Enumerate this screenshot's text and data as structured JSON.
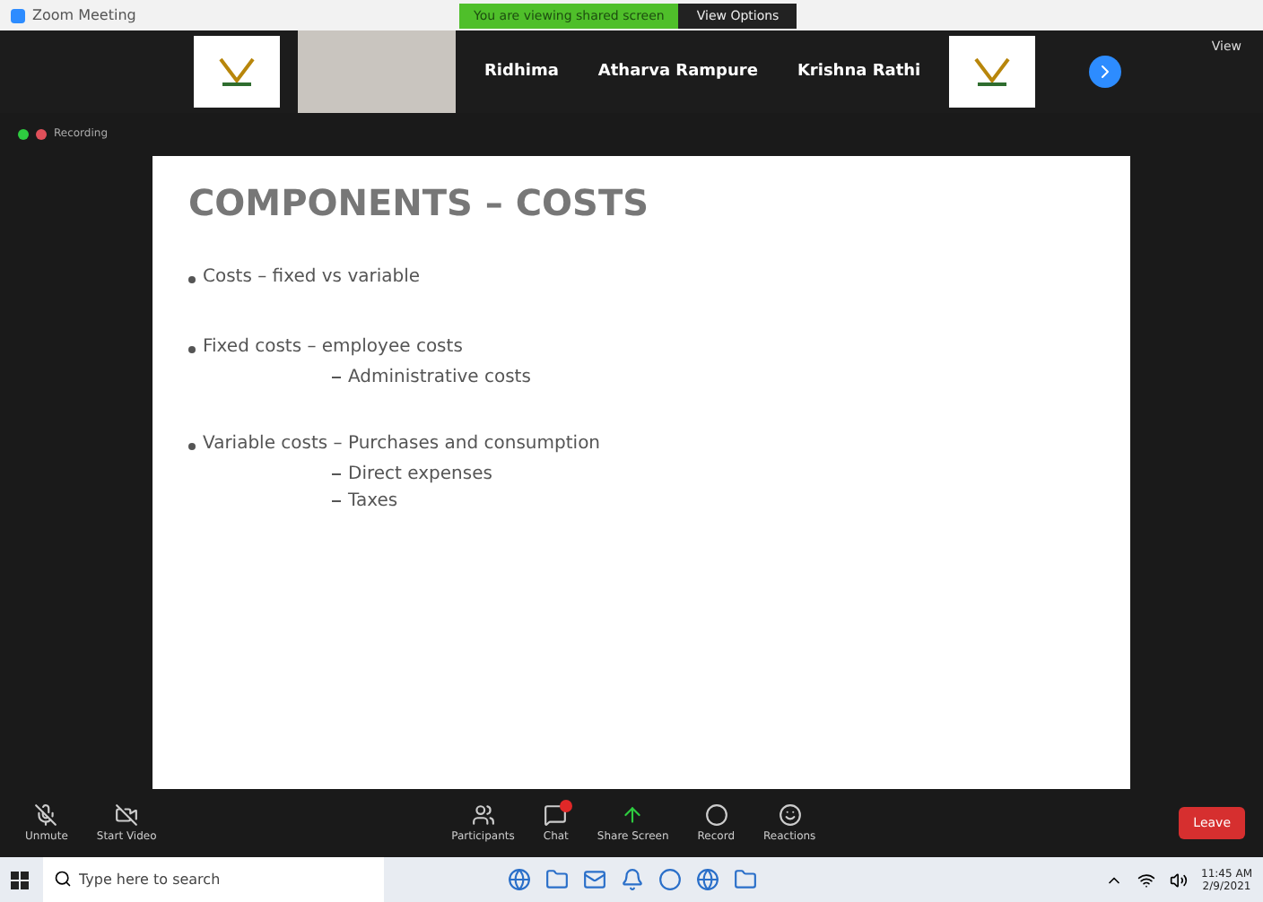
{
  "window": {
    "title": "Zoom Meeting"
  },
  "share_banner": {
    "text": "You are viewing shared screen",
    "button": "View Options"
  },
  "gallery": [
    {
      "kind": "logo"
    },
    {
      "kind": "video"
    },
    {
      "kind": "name",
      "name": "Ridhima"
    },
    {
      "kind": "name",
      "name": "Atharva Rampure"
    },
    {
      "kind": "name",
      "name": "Krishna Rathi"
    },
    {
      "kind": "logo"
    }
  ],
  "view_button": "View",
  "recording": {
    "label": "Recording",
    "on": true
  },
  "slide": {
    "title": "COMPONENTS – COSTS",
    "bullets": [
      {
        "text": "Costs – fixed vs variable"
      },
      {
        "text": "Fixed costs – employee costs",
        "children": [
          "Administrative costs"
        ]
      },
      {
        "text": "Variable costs – Purchases and consumption",
        "children": [
          "Direct expenses",
          "Taxes"
        ]
      }
    ]
  },
  "toolbar": [
    {
      "kind": "mic",
      "label": "Unmute",
      "alert": false
    },
    {
      "kind": "video",
      "label": "Start Video",
      "alert": false
    },
    {
      "kind": "participants",
      "label": "Participants",
      "alert": false
    },
    {
      "kind": "chat",
      "label": "Chat",
      "alert": true
    },
    {
      "kind": "share",
      "label": "Share Screen",
      "alert": false
    },
    {
      "kind": "record",
      "label": "Record",
      "alert": false
    },
    {
      "kind": "reactions",
      "label": "Reactions",
      "alert": false
    }
  ],
  "leave_button": "Leave",
  "taskbar": {
    "search_placeholder": "Type here to search",
    "time": "11:45 AM",
    "date": "2/9/2021"
  }
}
